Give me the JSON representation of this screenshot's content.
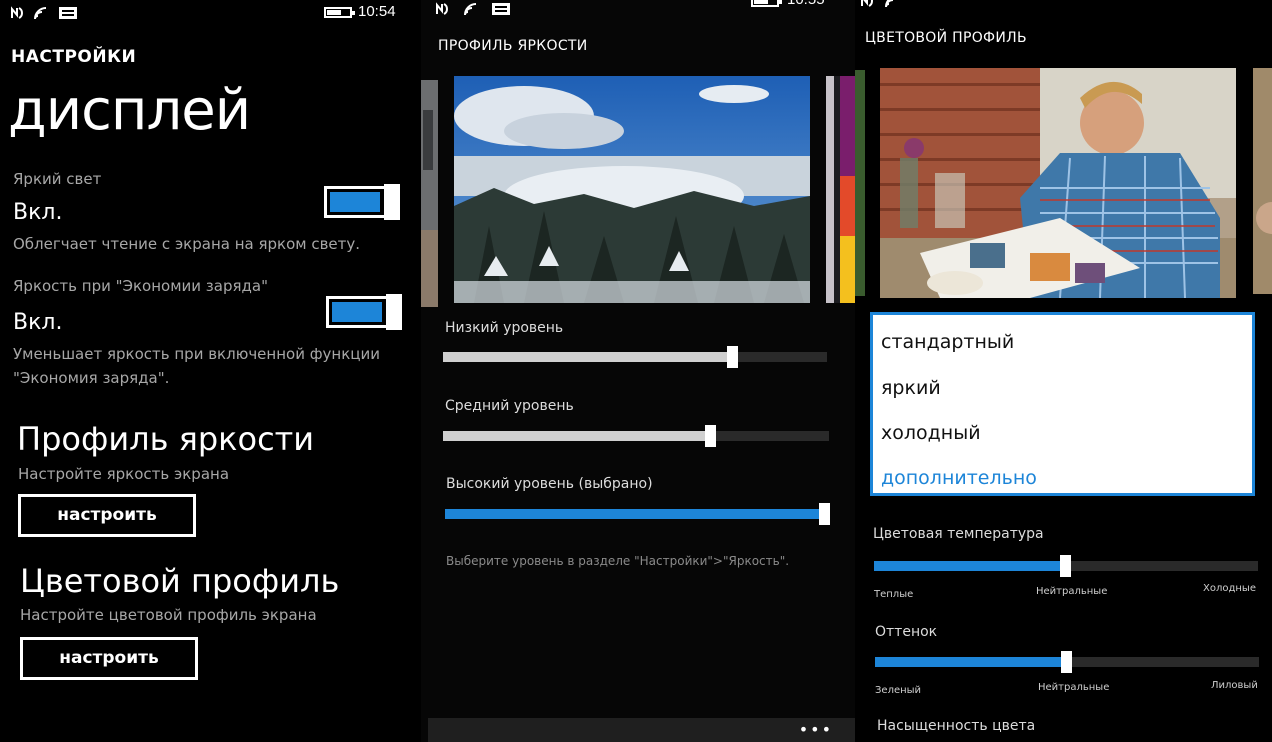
{
  "colors": {
    "accent": "#1d85d8",
    "background": "#000000",
    "secondary_text": "#a7a7a7"
  },
  "status_bar": {
    "icons": [
      "nfc-icon",
      "signal-icon",
      "message-icon"
    ],
    "time": "10:54",
    "time2": "10:55"
  },
  "display": {
    "app_title": "НАСТРОЙКИ",
    "page_title": "дисплей",
    "bright_light": {
      "label": "Яркий свет",
      "value": "Вкл.",
      "description": "Облегчает чтение с экрана на ярком свету.",
      "on": true
    },
    "battery_saver": {
      "label": "Яркость при \"Экономии заряда\"",
      "value": "Вкл.",
      "description_1": "Уменьшает яркость при включенной функции",
      "description_2": "\"Экономия заряда\".",
      "on": true
    },
    "brightness_profile": {
      "heading": "Профиль яркости",
      "subtitle": "Настройте яркость экрана",
      "button": "настроить"
    },
    "color_profile": {
      "heading": "Цветовой профиль",
      "subtitle": "Настройте цветовой профиль экрана",
      "button": "настроить"
    }
  },
  "brightness": {
    "header": "ПРОФИЛЬ ЯРКОСТИ",
    "photo_icon": "mountain-landscape-photo",
    "sliders": [
      {
        "label": "Низкий уровень",
        "value": 0.75
      },
      {
        "label": "Средний уровень",
        "value": 0.69
      },
      {
        "label": "Высокий уровень (выбрано)",
        "value": 1.0
      }
    ],
    "hint": "Выберите уровень в разделе \"Настройки\">\"Яркость\".",
    "more_label": "•••"
  },
  "color": {
    "header": "ЦВЕТОВОЙ ПРОФИЛЬ",
    "photo_icon": "man-reading-magazine-photo",
    "options": [
      "стандартный",
      "яркий",
      "холодный",
      "дополнительно"
    ],
    "selected_index": 3,
    "temperature": {
      "label": "Цветовая температура",
      "value": 0.5,
      "left": "Теплые",
      "middle": "Нейтральные",
      "right": "Холодные"
    },
    "tint": {
      "label": "Оттенок",
      "value": 0.5,
      "left": "Зеленый",
      "middle": "Нейтральные",
      "right": "Лиловый"
    },
    "saturation": {
      "label": "Насыщенность цвета"
    }
  }
}
